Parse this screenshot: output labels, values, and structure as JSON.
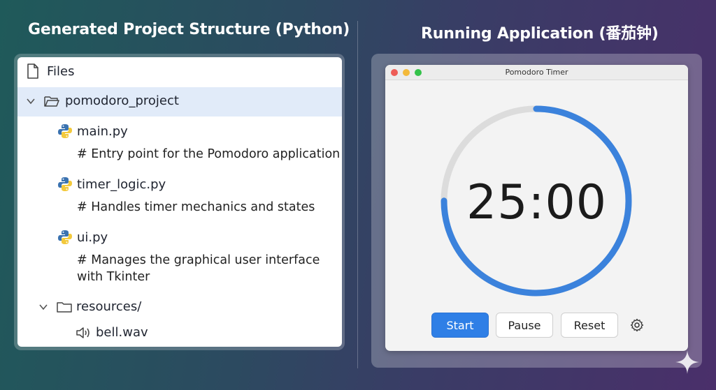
{
  "left_heading": "Generated Project Structure (Python)",
  "right_heading": "Running Application (番茄钟)",
  "file_tree": {
    "header": "Files",
    "project_folder": "pomodoro_project",
    "files": [
      {
        "name": "main.py",
        "comment": "# Entry point for the Pomodoro application"
      },
      {
        "name": "timer_logic.py",
        "comment": "# Handles timer mechanics and states"
      },
      {
        "name": "ui.py",
        "comment_line1": "# Manages the graphical user interface",
        "comment_line2": "with Tkinter"
      }
    ],
    "resources_folder": "resources/",
    "resource_file": "bell.wav"
  },
  "app_window": {
    "title": "Pomodoro Timer",
    "time_display": "25:00",
    "progress_fraction": 0.75,
    "buttons": {
      "start": "Start",
      "pause": "Pause",
      "reset": "Reset"
    },
    "settings_icon": "gear-icon"
  },
  "colors": {
    "accent_blue": "#2f7fe6",
    "ring_track": "#dcdcdc",
    "ring_progress": "#3b82dc",
    "selection": "#e1ebf9"
  }
}
